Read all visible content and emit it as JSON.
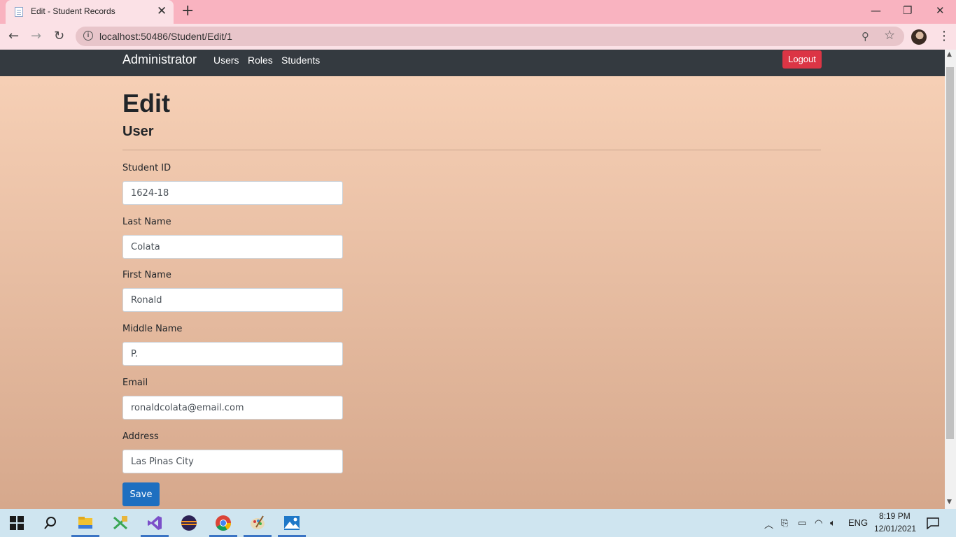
{
  "browser": {
    "tab_title": "Edit - Student Records",
    "url": "localhost:50486/Student/Edit/1"
  },
  "navbar": {
    "brand": "Administrator",
    "links": [
      "Users",
      "Roles",
      "Students"
    ],
    "logout": "Logout"
  },
  "page": {
    "heading": "Edit",
    "subheading": "User"
  },
  "form": {
    "fields": [
      {
        "label": "Student ID",
        "value": "1624-18"
      },
      {
        "label": "Last Name",
        "value": "Colata"
      },
      {
        "label": "First Name",
        "value": "Ronald"
      },
      {
        "label": "Middle Name",
        "value": "P."
      },
      {
        "label": "Email",
        "value": "ronaldcolata@email.com"
      },
      {
        "label": "Address",
        "value": "Las Pinas City"
      }
    ],
    "save_label": "Save"
  },
  "taskbar": {
    "language": "ENG",
    "time": "8:19 PM",
    "date": "12/01/2021",
    "apps": [
      "file-explorer-icon",
      "xaml-tool-icon",
      "visual-studio-icon",
      "eclipse-icon",
      "chrome-icon",
      "paint-icon",
      "photos-icon"
    ]
  },
  "colors": {
    "navbar_bg": "#343a40",
    "logout_bg": "#dc3545",
    "save_bg": "#1e6fc0",
    "gradient_top": "#f8d2b8",
    "gradient_bottom": "#d6a88c"
  }
}
